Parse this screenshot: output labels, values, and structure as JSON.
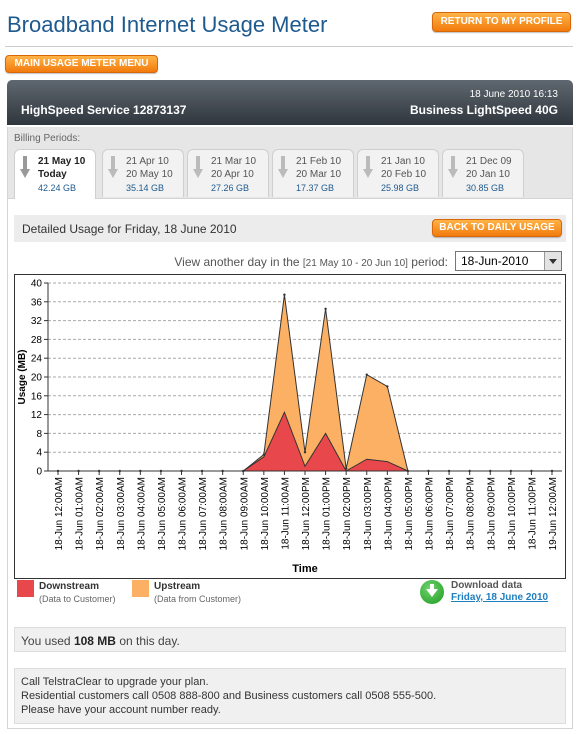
{
  "header": {
    "title": "Broadband Internet Usage Meter",
    "return_label": "RETURN TO MY PROFILE",
    "menu_label": "MAIN USAGE METER MENU"
  },
  "service": {
    "name": "HighSpeed Service 12873137",
    "datetime": "18 June 2010 16:13",
    "plan": "Business LightSpeed 40G"
  },
  "billing": {
    "label": "Billing Periods:",
    "periods": [
      {
        "from": "21 May 10",
        "to": "Today",
        "usage": "42.24 GB"
      },
      {
        "from": "21 Apr 10",
        "to": "20 May 10",
        "usage": "35.14 GB"
      },
      {
        "from": "21 Mar 10",
        "to": "20 Apr 10",
        "usage": "27.26 GB"
      },
      {
        "from": "21 Feb 10",
        "to": "20 Mar 10",
        "usage": "17.37 GB"
      },
      {
        "from": "21 Jan 10",
        "to": "20 Feb 10",
        "usage": "25.98 GB"
      },
      {
        "from": "21 Dec 09",
        "to": "20 Jan 10",
        "usage": "30.85 GB"
      }
    ]
  },
  "detail": {
    "title": "Detailed Usage for Friday, 18 June 2010",
    "back_label": "BACK TO DAILY USAGE",
    "another_prefix": "View another day in the ",
    "another_range": "[21 May 10 - 20 Jun 10]",
    "another_suffix": " period:",
    "selected_day": "18-Jun-2010"
  },
  "chart_data": {
    "type": "area",
    "xlabel": "Time",
    "ylabel": "Usage (MB)",
    "ylim": [
      0,
      40
    ],
    "yticks": [
      0,
      4,
      8,
      12,
      16,
      20,
      24,
      28,
      32,
      36,
      40
    ],
    "grid": true,
    "categories": [
      "18-Jun 12:00AM",
      "18-Jun 01:00AM",
      "18-Jun 02:00AM",
      "18-Jun 03:00AM",
      "18-Jun 04:00AM",
      "18-Jun 05:00AM",
      "18-Jun 06:00AM",
      "18-Jun 07:00AM",
      "18-Jun 08:00AM",
      "18-Jun 09:00AM",
      "18-Jun 10:00AM",
      "18-Jun 11:00AM",
      "18-Jun 12:00PM",
      "18-Jun 01:00PM",
      "18-Jun 02:00PM",
      "18-Jun 03:00PM",
      "18-Jun 04:00PM",
      "18-Jun 05:00PM",
      "18-Jun 06:00PM",
      "18-Jun 07:00PM",
      "18-Jun 08:00PM",
      "18-Jun 09:00PM",
      "18-Jun 10:00PM",
      "18-Jun 11:00PM",
      "19-Jun 12:00AM"
    ],
    "series": [
      {
        "name": "Downstream",
        "color": "#e8474b",
        "values": [
          0,
          0,
          0,
          0,
          0,
          0,
          0,
          0,
          0,
          0,
          3,
          12.5,
          1,
          8,
          0,
          2.5,
          2,
          0,
          0,
          0,
          0,
          0,
          0,
          0,
          0
        ]
      },
      {
        "name": "Upstream",
        "color": "#fbb064",
        "values": [
          0,
          0,
          0,
          0,
          0,
          0,
          0,
          0,
          0,
          0,
          0.5,
          25,
          3,
          26.5,
          0.5,
          18,
          16,
          0,
          0,
          0,
          0,
          0,
          0,
          0,
          0
        ]
      }
    ]
  },
  "legend": {
    "downstream": {
      "label": "Downstream",
      "sub": "(Data to Customer)",
      "color": "#e8474b"
    },
    "upstream": {
      "label": "Upstream",
      "sub": "(Data from Customer)",
      "color": "#fbb064"
    }
  },
  "download": {
    "title": "Download data",
    "link": "Friday, 18 June 2010"
  },
  "usage_summary": {
    "prefix": "You used ",
    "amount": "108 MB",
    "suffix": " on this day."
  },
  "contact": {
    "line1": "Call TelstraClear to upgrade your plan.",
    "line2": "Residential customers call 0508 888-800 and Business customers call 0508 555-500.",
    "line3": "Please have your account number ready."
  }
}
